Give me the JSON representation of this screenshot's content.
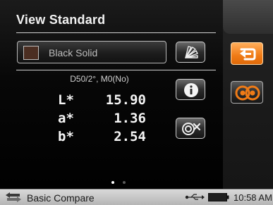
{
  "header": {
    "title": "View Standard"
  },
  "standard": {
    "name": "Black Solid",
    "swatch_color": "#4b2e22"
  },
  "measurement": {
    "illuminant": "D50/2°, M0(No)",
    "values": [
      {
        "label": "L*",
        "value": "15.90"
      },
      {
        "label": "a*",
        "value": "1.36"
      },
      {
        "label": "b*",
        "value": "2.54"
      }
    ]
  },
  "pagination": {
    "pages": 2,
    "current": 1
  },
  "statusbar": {
    "label": "Basic Compare",
    "time": "10:58 AM"
  },
  "colors": {
    "accent": "#f07b16",
    "text": "#f2f2f2"
  },
  "icons": {
    "fan": "fan-deck-icon",
    "info": "info-icon",
    "compare": "compare-remove-icon",
    "back": "back-icon",
    "measure": "measure-icon",
    "usb": "usb-icon",
    "battery": "battery-icon"
  }
}
